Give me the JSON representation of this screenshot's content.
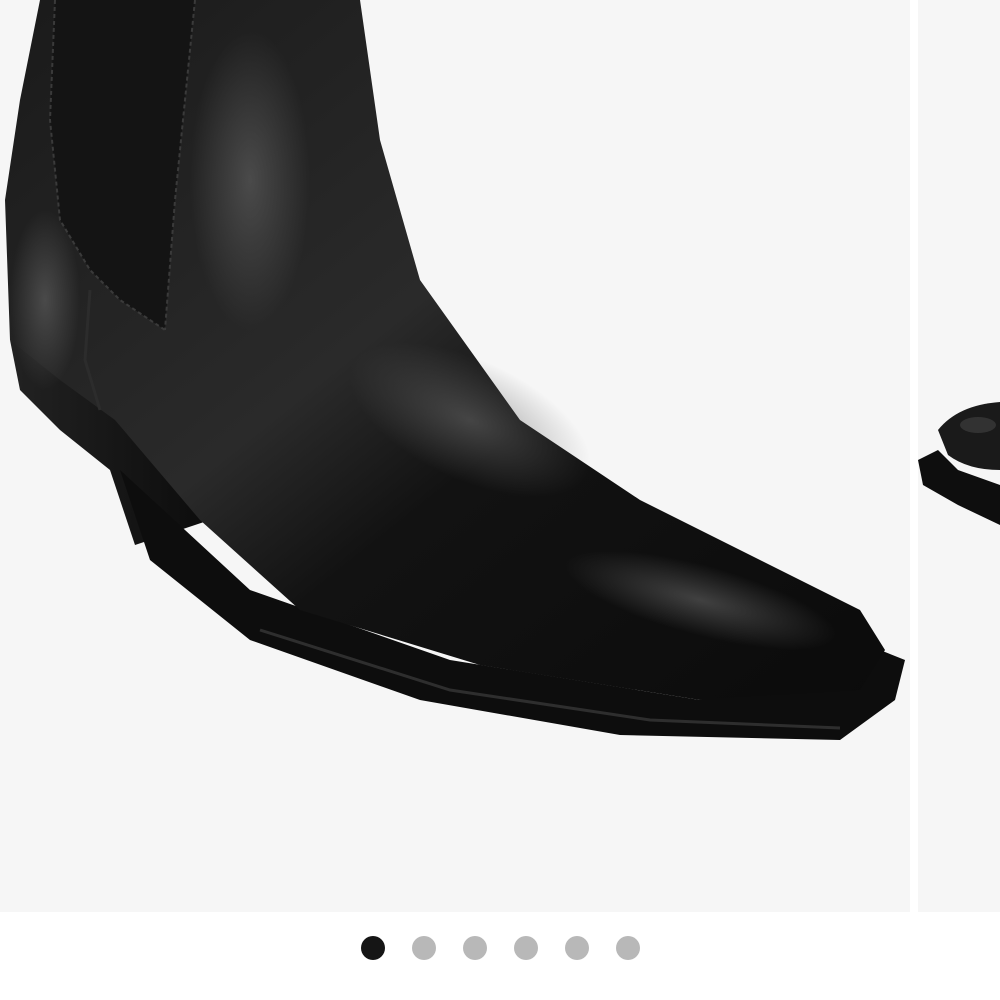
{
  "carousel": {
    "total_slides": 6,
    "active_index": 0,
    "slides": [
      {
        "icon": "product-photo-black-leather-chelsea-boot-side"
      },
      {
        "icon": "product-photo-black-leather-boot-partial"
      }
    ],
    "dot_colors": {
      "active": "#151515",
      "inactive": "#b8b8b8"
    },
    "background_color": "#f6f6f6"
  }
}
